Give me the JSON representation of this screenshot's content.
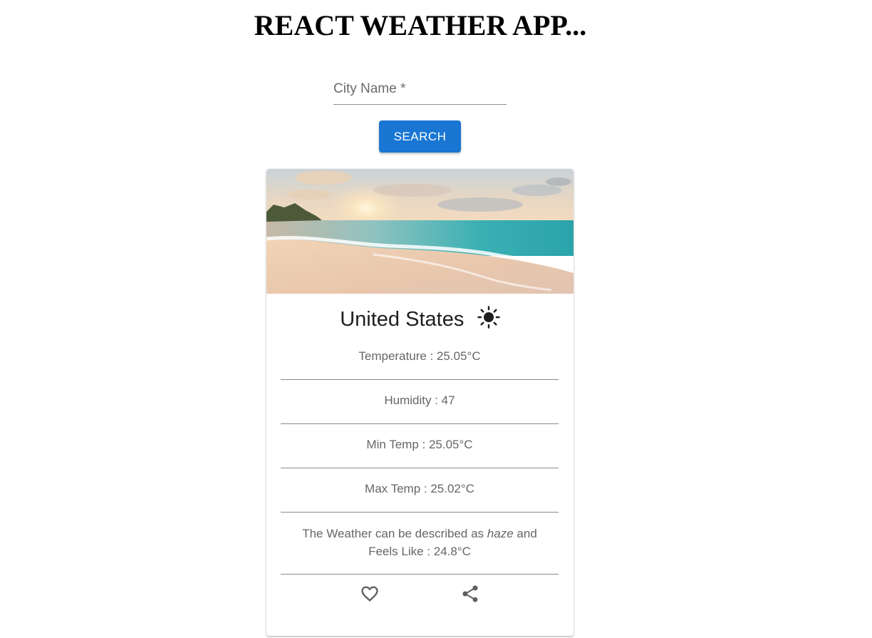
{
  "header": {
    "title": "REACT WEATHER APP..."
  },
  "search": {
    "label": "City Name *",
    "value": "",
    "button_label": "SEARCH"
  },
  "card": {
    "city": "United States",
    "weather_icon": "sun-icon",
    "temperature": "Temperature : 25.05°C",
    "humidity": "Humidity : 47",
    "min_temp": "Min Temp : 25.05°C",
    "max_temp": "Max Temp : 25.02°C",
    "description_prefix": "The Weather can be described as",
    "description_value": "haze",
    "description_suffix": "and",
    "feels_like": "Feels Like : 24.8°C",
    "actions": {
      "favorite_icon": "heart-outline-icon",
      "share_icon": "share-icon"
    }
  },
  "colors": {
    "primary": "#1976d2",
    "text_secondary": "#666666"
  }
}
